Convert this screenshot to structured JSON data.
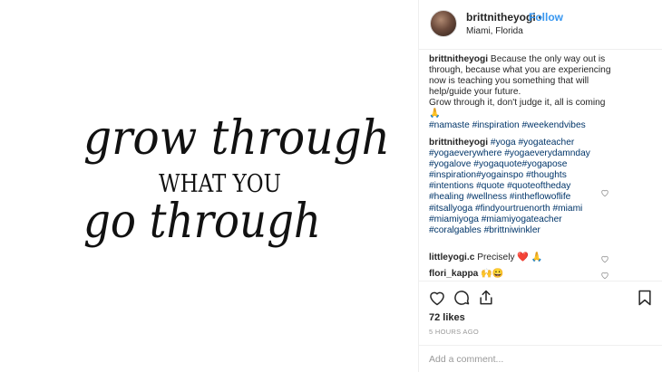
{
  "post": {
    "quote_lines": [
      "grow through",
      "WHAT YOU",
      "go through"
    ]
  },
  "header": {
    "username": "brittnitheyogi",
    "dot": "•",
    "follow_label": "Follow",
    "location": "Miami, Florida"
  },
  "caption": {
    "username": "brittnitheyogi",
    "lines": [
      " Because the only way out is",
      "through, because what you are experiencing",
      "now is teaching you something that will",
      "help/guide your future.",
      "Grow through it, don't judge it, all is coming",
      "🙏",
      "#namaste #inspiration #weekendvibes"
    ]
  },
  "hashtag_comment": {
    "username": "brittnitheyogi",
    "lines": [
      " #yoga #yogateacher",
      "#yogaeverywhere #yogaeverydamnday",
      "#yogalove #yogaquote#yogapose",
      "#inspiration#yogainspo #thoughts",
      "#intentions #quote #quoteoftheday",
      "#healing #wellness #intheflowoflife",
      "#itsallyoga #findyourtruenorth #miami",
      "#miamiyoga #miamiyogateacher",
      "#coralgables #brittniwinkler"
    ]
  },
  "comments": [
    {
      "username": "littleyogi.c",
      "text": " Precisely ❤️ 🙏"
    },
    {
      "username": "flori_kappa",
      "text": " 🙌😀"
    }
  ],
  "actions": {
    "icons": [
      "heart-icon",
      "comment-icon",
      "share-icon",
      "bookmark-icon"
    ],
    "likes": "72 likes",
    "time": "5 HOURS AGO",
    "comment_placeholder": "Add a comment..."
  },
  "colors": {
    "link": "#3897f0",
    "hashtag": "#003569",
    "muted": "#999999",
    "text": "#262626"
  }
}
